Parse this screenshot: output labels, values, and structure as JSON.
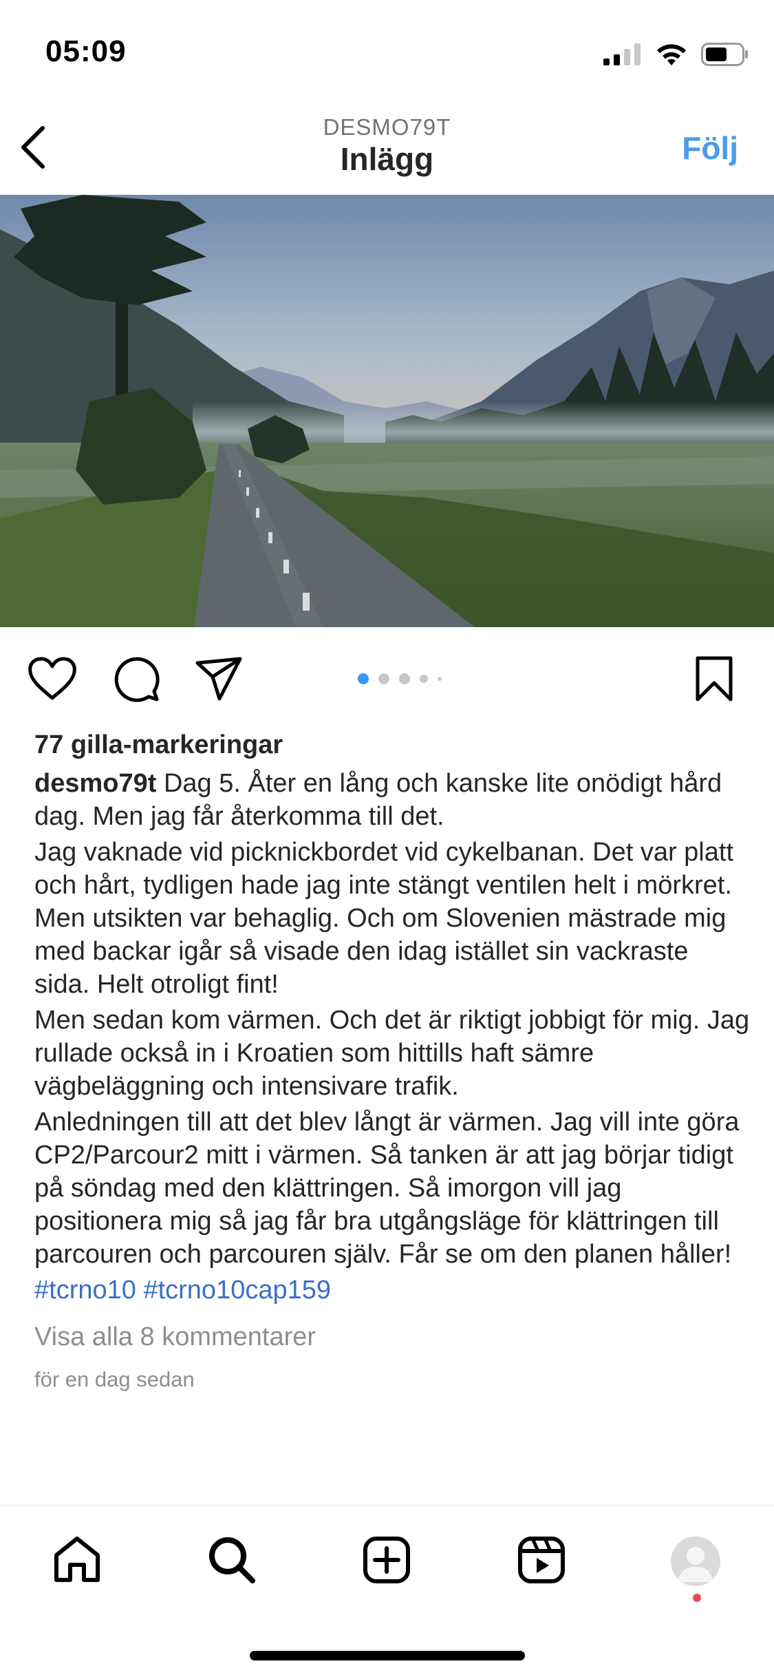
{
  "status_bar": {
    "time": "05:09"
  },
  "header": {
    "username": "DESMO79T",
    "title": "Inlägg",
    "follow_label": "Följ"
  },
  "carousel": {
    "total_slides": 5,
    "active_index": 0
  },
  "post": {
    "likes": "77 gilla-markeringar",
    "author": "desmo79t",
    "caption_first": " Dag 5. Åter en lång och kanske lite onödigt hård dag. Men jag får återkomma till det.",
    "paragraphs": [
      "Jag vaknade vid picknickbordet vid cykelbanan. Det var platt och hårt, tydligen hade jag inte stängt ventilen helt i mörkret. Men utsikten var behaglig. Och om Slovenien mästrade mig med backar igår så visade den idag istället sin vackraste sida. Helt otroligt fint!",
      "Men sedan kom värmen. Och det är riktigt jobbigt för mig. Jag rullade också in i Kroatien som hittills haft sämre vägbeläggning och intensivare trafik.",
      "Anledningen till att det blev långt är värmen. Jag vill inte göra CP2/Parcour2 mitt i värmen. Så tanken är att jag börjar tidigt på söndag med den klättringen. Så imorgon vill jag positionera mig så jag får bra utgångsläge för klättringen till parcouren och parcouren själv. Får se om den planen håller!"
    ],
    "hashtags": [
      "#tcrno10",
      "#tcrno10cap159"
    ],
    "view_comments": "Visa alla 8 kommentarer",
    "timestamp": "för en dag sedan"
  },
  "colors": {
    "accent": "#4a9bec",
    "hashtag": "#3a70c4",
    "muted": "#8e8e8e",
    "notification": "#ed4956"
  },
  "icons": {
    "back": "chevron-left-icon",
    "like": "heart-icon",
    "comment": "comment-bubble-icon",
    "share": "paper-plane-icon",
    "save": "bookmark-icon",
    "home": "home-icon",
    "search": "search-icon",
    "create": "plus-square-icon",
    "reels": "reels-icon",
    "profile": "avatar"
  }
}
